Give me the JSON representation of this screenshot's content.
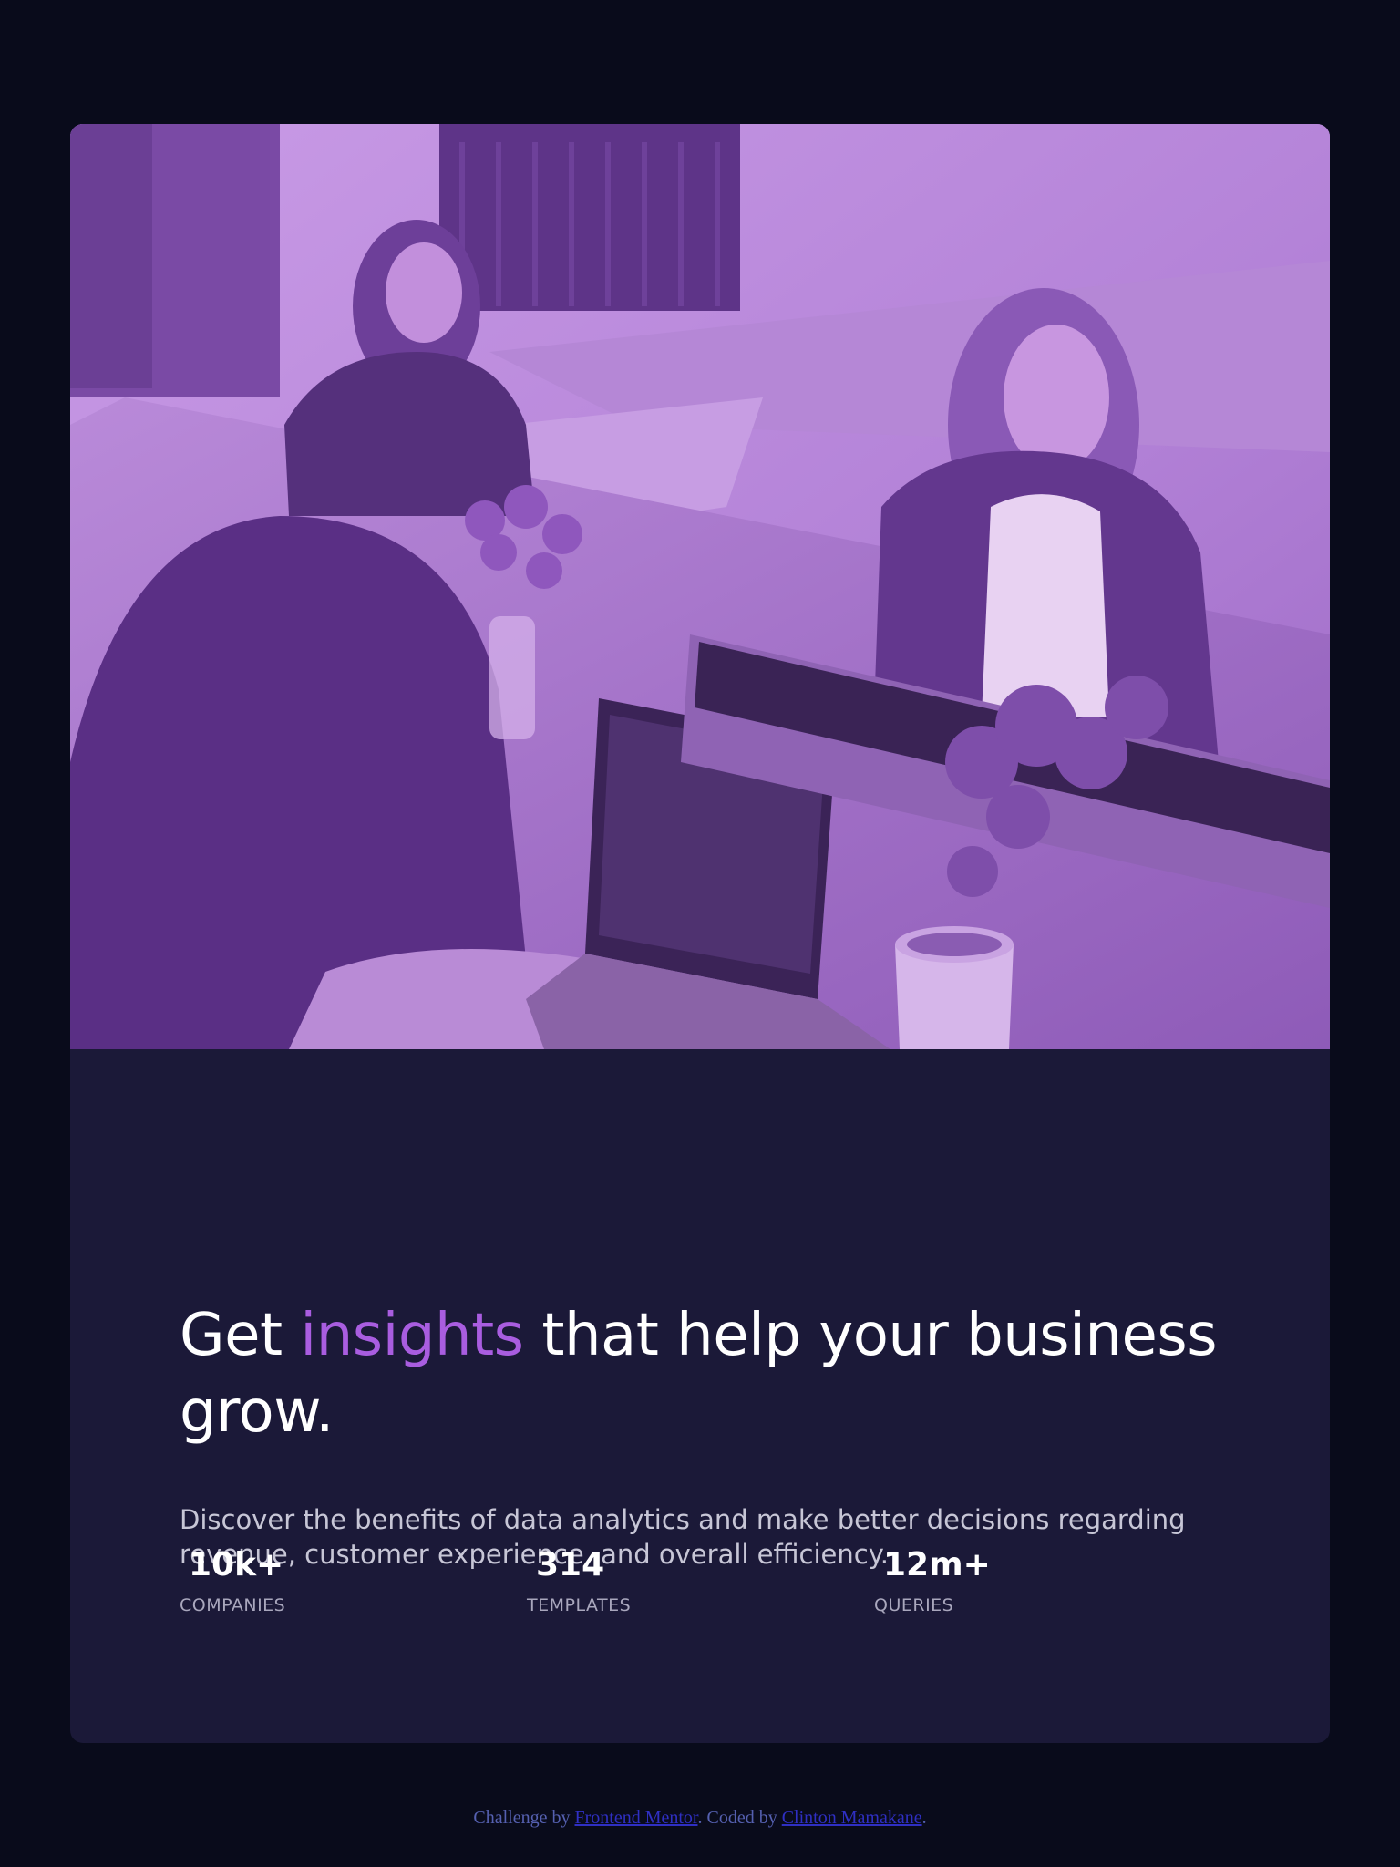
{
  "card": {
    "hero_image_alt": "Three women working at a desk with laptops",
    "heading": {
      "before": "Get",
      "accent": "insights",
      "after": "that help your business grow."
    },
    "description": "Discover the benefits of data analytics and make better decisions regarding revenue, customer experience, and overall efficiency.",
    "stats": [
      {
        "value": "10k+",
        "label": "COMPANIES"
      },
      {
        "value": "314",
        "label": "TEMPLATES"
      },
      {
        "value": "12m+",
        "label": "QUERIES"
      }
    ]
  },
  "attribution": {
    "prefix": "Challenge by",
    "link1": "Frontend Mentor",
    "middle": ". Coded by",
    "link2": "Clinton Mamakane",
    "suffix": "."
  },
  "colors": {
    "page_background": "#090b1b",
    "card_background": "#1b1938",
    "accent": "#a95de0",
    "image_overlay": "#a66bd3",
    "text_primary": "#ffffff",
    "text_secondary": "#c7c6d6",
    "link": "#2f2fc3"
  }
}
